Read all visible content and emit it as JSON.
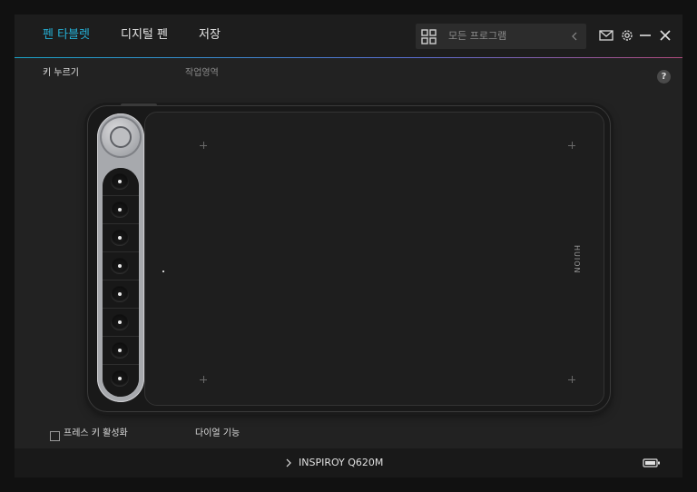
{
  "nav": {
    "tabs": [
      {
        "label": "펜 타블렛",
        "active": true
      },
      {
        "label": "디지털 펜",
        "active": false
      },
      {
        "label": "저장",
        "active": false
      }
    ],
    "program_selector": {
      "label": "모든 프로그램",
      "icon": "grid-icon"
    }
  },
  "subtabs": [
    {
      "label": "키 누르기",
      "active": true
    },
    {
      "label": "작업영역",
      "active": false
    }
  ],
  "help_label": "?",
  "tablet": {
    "brand": "HUION",
    "key_count": 8
  },
  "options": {
    "press_key_label": "프레스 키 활성화",
    "dial_label": "다이얼 기능"
  },
  "footer": {
    "device_name": "INSPIROY Q620M"
  },
  "colors": {
    "accent": "#25b0d6",
    "background": "#222222",
    "header": "#1d1d1d"
  }
}
